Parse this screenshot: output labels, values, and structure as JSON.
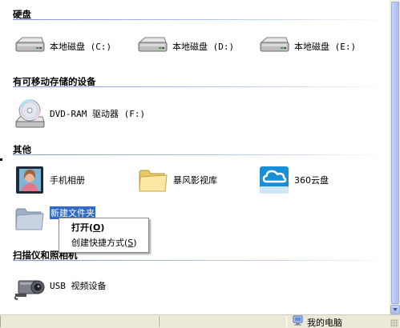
{
  "groups": {
    "hard_disks": {
      "title": "硬盘"
    },
    "removable": {
      "title": "有可移动存储的设备"
    },
    "other": {
      "title": "其他"
    },
    "scanners": {
      "title": "扫描仪和照相机"
    }
  },
  "drives": [
    {
      "label": "本地磁盘 (C:)",
      "icon": "hard-drive-icon"
    },
    {
      "label": "本地磁盘 (D:)",
      "icon": "hard-drive-icon"
    },
    {
      "label": "本地磁盘 (E:)",
      "icon": "hard-drive-icon"
    }
  ],
  "removable": [
    {
      "label": "DVD-RAM 驱动器 (F:)",
      "icon": "dvd-drive-icon"
    }
  ],
  "other": [
    {
      "label": "手机相册",
      "icon": "phone-album-icon"
    },
    {
      "label": "暴风影视库",
      "icon": "folder-icon"
    },
    {
      "label": "360云盘",
      "icon": "cloud-drive-icon"
    },
    {
      "label": "新建文件夹",
      "icon": "folder-icon",
      "selected": true
    }
  ],
  "scanners": [
    {
      "label": "USB 视频设备",
      "icon": "webcam-icon"
    }
  ],
  "context_menu": {
    "open": {
      "label": "打开",
      "accel": "O"
    },
    "create_shortcut": {
      "label": "创建快捷方式",
      "accel": "S"
    }
  },
  "statusbar": {
    "location": "我的电脑",
    "icon": "my-computer-icon"
  },
  "colors": {
    "selection": "#316ac5",
    "group_line": "#7a96df",
    "statusbar": "#ece9d8"
  }
}
